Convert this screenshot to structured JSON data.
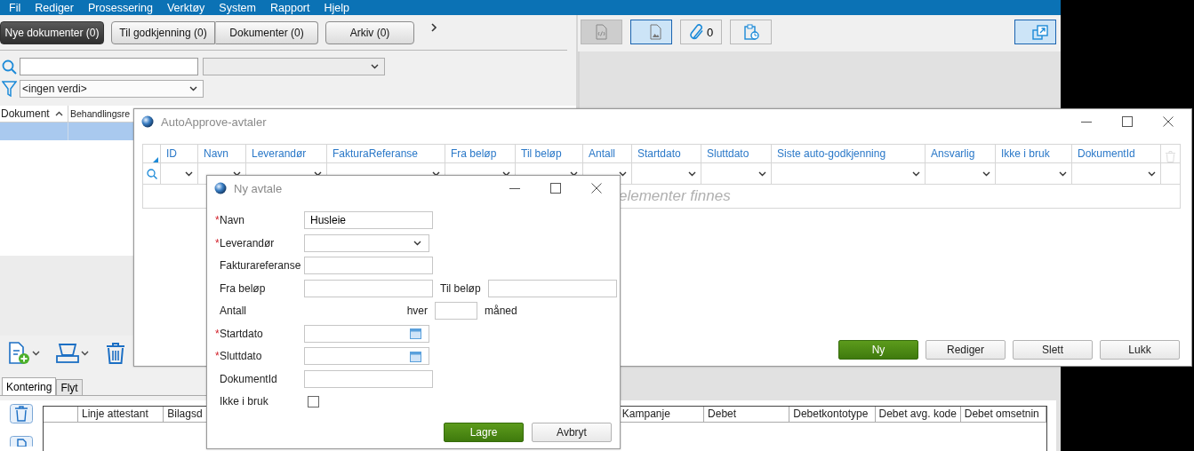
{
  "menu": [
    "Fil",
    "Rediger",
    "Prosessering",
    "Verktøy",
    "System",
    "Rapport",
    "Hjelp"
  ],
  "left_panel": {
    "tabs": [
      {
        "label": "Nye dokumenter (0)",
        "selected": true
      },
      {
        "label": "Til godkjenning (0)",
        "selected": false
      },
      {
        "label": "Dokumenter (0)",
        "selected": false
      },
      {
        "label": "Arkiv (0)",
        "selected": false
      }
    ],
    "filter": {
      "value": "<ingen verdi>"
    },
    "table": {
      "columns": [
        "Dokument",
        "Behandlingsre"
      ]
    },
    "bottom_tabs": [
      {
        "label": "Kontering",
        "selected": true
      },
      {
        "label": "Flyt",
        "selected": false
      }
    ],
    "bottom_grid": {
      "columns_left": [
        "Linje attestant",
        "Bilagsd"
      ],
      "columns_right": [
        "Kampanje",
        "Debet",
        "Debetkontotype",
        "Debet avg. kode",
        "Debet omsetnin"
      ]
    }
  },
  "preview_toolbar": [
    {
      "kind": "code",
      "disabled": true,
      "selected": false
    },
    {
      "kind": "image",
      "disabled": false,
      "selected": true
    },
    {
      "kind": "attachment",
      "disabled": false,
      "selected": false,
      "count": "0"
    },
    {
      "kind": "clipboard",
      "disabled": false,
      "selected": false
    },
    {
      "kind": "expand",
      "disabled": false,
      "selected": true
    }
  ],
  "autoapprove_window": {
    "title": "AutoApprove-avtaler",
    "columns": [
      "ID",
      "Navn",
      "Leverandør",
      "FakturaReferanse",
      "Fra beløp",
      "Til beløp",
      "Antall",
      "Startdato",
      "Sluttdato",
      "Siste auto-godkjenning",
      "Ansvarlig",
      "Ikke i bruk",
      "DokumentId"
    ],
    "empty_text": "elementer finnes",
    "buttons": [
      {
        "label": "Ny",
        "kind": "primary"
      },
      {
        "label": "Rediger",
        "kind": "default"
      },
      {
        "label": "Slett",
        "kind": "default"
      },
      {
        "label": "Lukk",
        "kind": "default"
      }
    ]
  },
  "new_agreement_dialog": {
    "title": "Ny avtale",
    "fields": [
      {
        "label": "Navn",
        "mark": "*",
        "kind": "text",
        "value": "Husleie"
      },
      {
        "label": "Leverandør",
        "mark": "*",
        "kind": "select"
      },
      {
        "label": "Fakturareferanse",
        "kind": "text"
      },
      {
        "label": "Fra beløp",
        "kind": "range",
        "second_label": "Til beløp"
      },
      {
        "label": "Antall",
        "kind": "count",
        "prefix": "hver",
        "suffix": "måned"
      },
      {
        "label": "Startdato",
        "mark": "*",
        "kind": "date"
      },
      {
        "label": "Sluttdato",
        "mark": "*",
        "kind": "date"
      },
      {
        "label": "DokumentId",
        "kind": "text"
      },
      {
        "label": "Ikke i bruk",
        "kind": "checkbox",
        "checked": false
      }
    ],
    "buttons": [
      {
        "label": "Lagre",
        "kind": "primary"
      },
      {
        "label": "Avbryt",
        "kind": "default"
      }
    ]
  }
}
